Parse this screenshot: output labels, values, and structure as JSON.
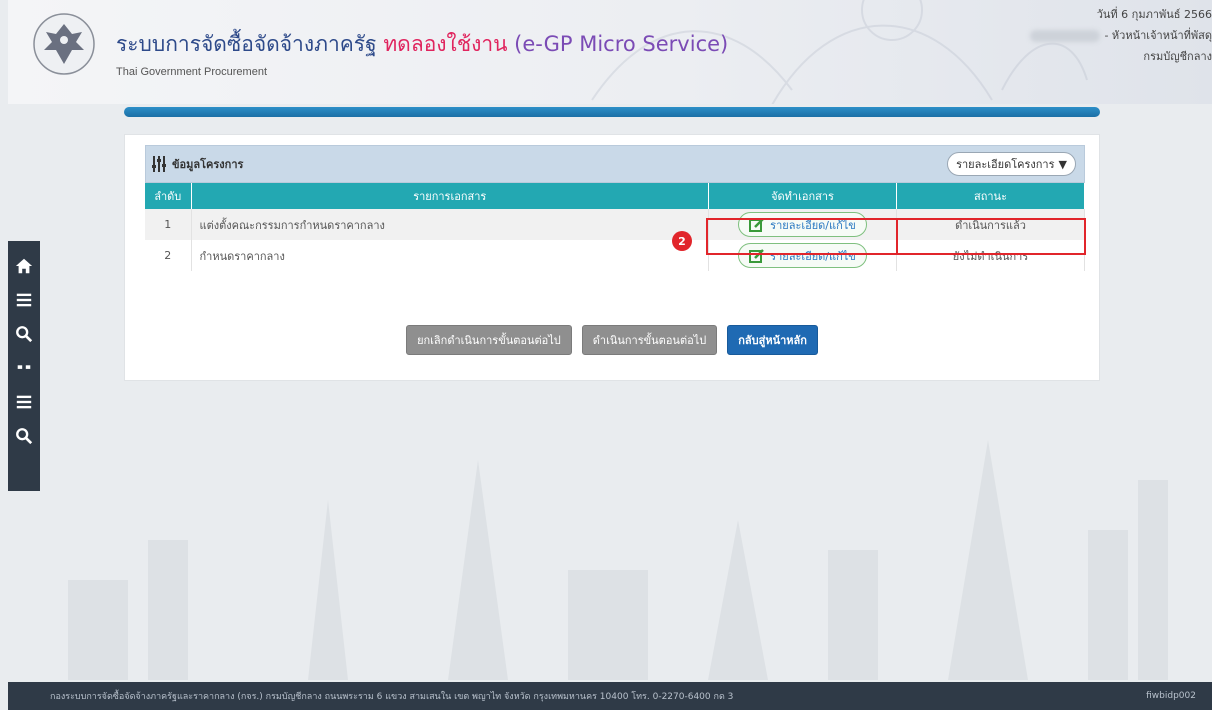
{
  "header": {
    "title_main": "ระบบการจัดซื้อจัดจ้างภาครัฐ",
    "title_trial": "ทดลองใช้งาน",
    "title_service": "(e-GP Micro Service)",
    "subtitle": "Thai Government Procurement",
    "date": "วันที่ 6 กุมภาพันธ์ 2566",
    "role": "- หัวหน้าเจ้าหน้าที่พัสดุ",
    "department": "กรมบัญชีกลาง"
  },
  "project": {
    "section_title": "ข้อมูลโครงการ",
    "detail_dropdown": "รายละเอียดโครงการ",
    "columns": [
      "ลำดับ",
      "รายการเอกสาร",
      "จัดทำเอกสาร",
      "สถานะ"
    ],
    "rows": [
      {
        "no": "1",
        "doc": "แต่งตั้งคณะกรรมการกำหนดราคากลาง",
        "action": "รายละเอียด/แก้ไข",
        "status": "ดำเนินการแล้ว"
      },
      {
        "no": "2",
        "doc": "กำหนดราคากลาง",
        "action": "รายละเอียด/แก้ไข",
        "status": "ยังไม่ดำเนินการ"
      }
    ]
  },
  "step_badge": "2",
  "buttons": {
    "cancel_next": "ยกเลิกดำเนินการขั้นตอนต่อไป",
    "proceed_next": "ดำเนินการขั้นตอนต่อไป",
    "back_home": "กลับสู่หน้าหลัก"
  },
  "footer": {
    "address": "กองระบบการจัดซื้อจัดจ้างภาครัฐและราคากลาง (กจร.) กรมบัญชีกลาง ถนนพระราม 6 แขวง สามเสนใน เขต พญาไท จังหวัด กรุงเทพมหานคร 10400 โทร. 0-2270-6400 กด 3",
    "page_code": "fiwbidp002"
  },
  "colors": {
    "table_header": "#23a8b2",
    "primary_button": "#1f6ab3",
    "highlight": "#e1252b"
  }
}
